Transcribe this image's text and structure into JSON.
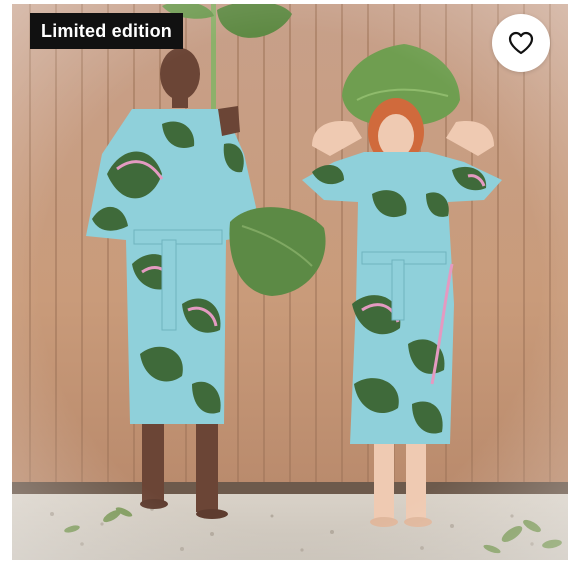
{
  "product_card": {
    "badge_label": "Limited edition",
    "favorite_icon": "heart-outline-icon",
    "colors": {
      "badge_bg": "#111111",
      "badge_text": "#ffffff",
      "favorite_bg": "#ffffff"
    }
  }
}
